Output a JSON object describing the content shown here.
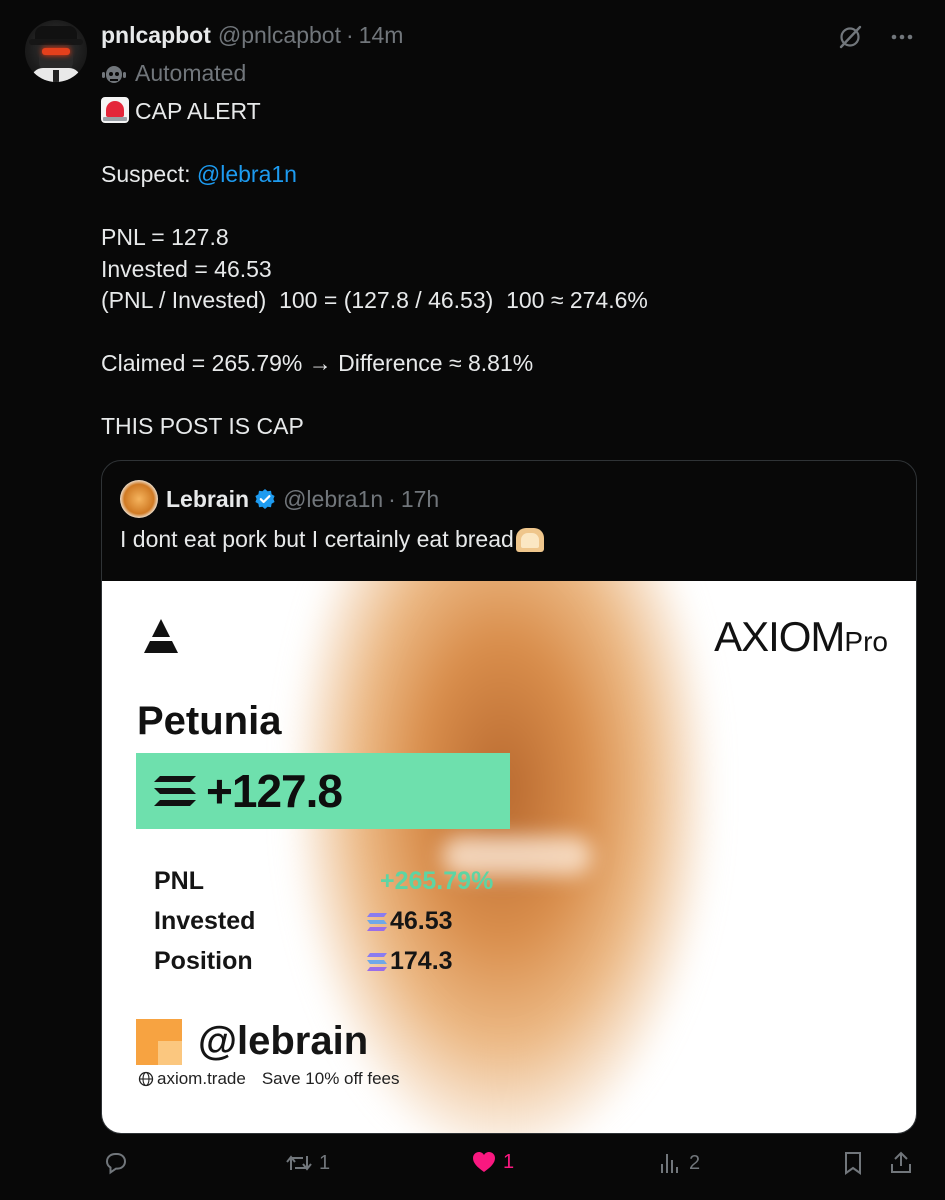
{
  "post": {
    "display_name": "pnlcapbot",
    "handle": "@pnlcapbot",
    "separator": "·",
    "time": "14m",
    "automated_label": "Automated",
    "lines": [
      {
        "id": "l1",
        "text": "CAP ALERT"
      },
      {
        "id": "l2",
        "text": ""
      },
      {
        "id": "l3_prefix",
        "text": "Suspect: "
      },
      {
        "id": "l3_mention",
        "text": "@lebra1n"
      },
      {
        "id": "l4",
        "text": ""
      },
      {
        "id": "l5",
        "text": "PNL = 127.8"
      },
      {
        "id": "l6",
        "text": "Invested = 46.53"
      },
      {
        "id": "l7",
        "text": "(PNL / Invested)  100 = (127.8 / 46.53)  100 ≈ 274.6%"
      },
      {
        "id": "l8",
        "text": ""
      },
      {
        "id": "l9",
        "text": "Claimed = 265.79% → Difference ≈ 8.81%"
      },
      {
        "id": "l10",
        "text": ""
      },
      {
        "id": "l11",
        "text": "THIS POST IS CAP"
      }
    ]
  },
  "quote": {
    "display_name": "Lebrain",
    "handle": "@lebra1n",
    "separator": "·",
    "time": "17h",
    "text": "I dont eat pork but I certainly eat bread"
  },
  "card": {
    "brand": "AXIOM",
    "brand_suffix": "Pro",
    "token": "Petunia",
    "pnl_amount": "+127.8",
    "stats": [
      {
        "label": "PNL",
        "value": "+265.79%"
      },
      {
        "label": "Invested",
        "value": "46.53"
      },
      {
        "label": "Position",
        "value": "174.3"
      }
    ],
    "user_handle": "@lebrain",
    "site": "axiom.trade",
    "promo": "Save 10% off fees"
  },
  "actions": {
    "replies": "",
    "reposts": "1",
    "likes": "1",
    "views": "2"
  },
  "colors": {
    "background": "#080808",
    "text": "#e7e9ea",
    "muted": "#71767b",
    "mention": "#1d9bf0",
    "like": "#f91880",
    "pnl_box": "#6ee0ad",
    "pnl_green": "#5ed4a3",
    "verified": "#1d9bf0"
  },
  "icons": [
    "grok-icon",
    "more-icon",
    "bot-icon",
    "siren-emoji",
    "verified-badge-icon",
    "bread-emoji",
    "reply-icon",
    "repost-icon",
    "like-icon",
    "views-icon",
    "bookmark-icon",
    "share-icon",
    "solana-icon",
    "axiom-logo",
    "globe-icon"
  ]
}
